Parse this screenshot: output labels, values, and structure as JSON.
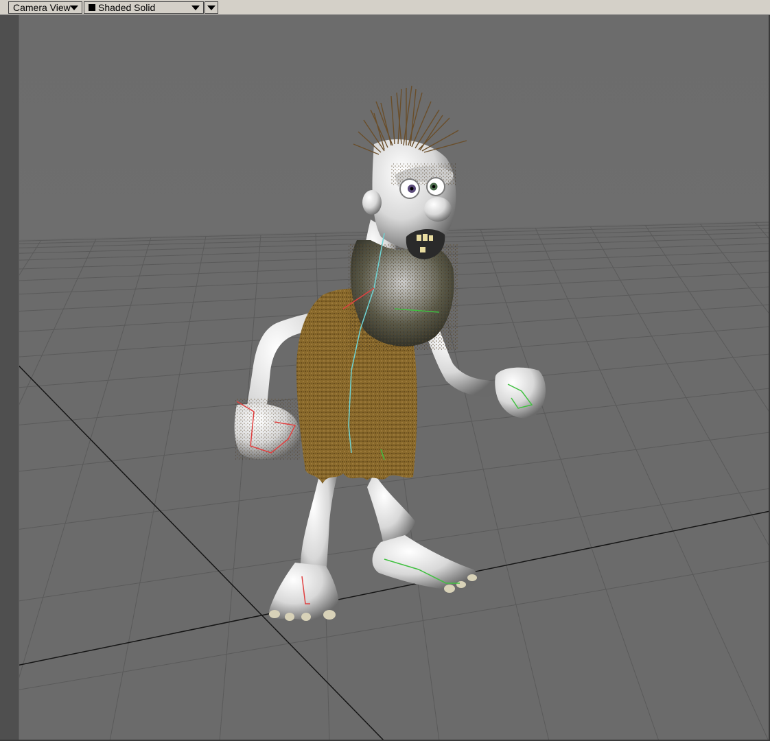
{
  "toolbar": {
    "view_label": "Camera View",
    "shading_label": "Shaded Solid"
  },
  "viewport": {
    "background_color": "#6e6e6e",
    "grid_color": "#585858",
    "axis_color": "#101010",
    "subject": "caveman-character-model"
  },
  "icons": {
    "view_dropdown": "chevron-down-icon",
    "shading_dropdown": "chevron-down-icon",
    "options_dropdown": "chevron-down-icon",
    "shading_swatch": "solid-square-icon"
  }
}
